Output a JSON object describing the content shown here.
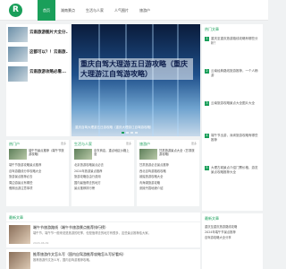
{
  "header": {
    "logo": "R",
    "nav": [
      "首页",
      "湖南景点",
      "生活与人家",
      "人气图片",
      "旅游户"
    ]
  },
  "featured_list": {
    "items": [
      "云南旅游图片大全分...",
      "这都可以？！云南旅...",
      "云南旅游攻略必看..."
    ]
  },
  "banner": {
    "headline": "重庆自驾大理游五日游攻略（重庆大理游江自驾游攻略）",
    "caption": "重庆自驾大理游五日游攻略（重庆大理游江自驾游攻略）"
  },
  "right_hot": {
    "title": "热门文章",
    "items": [
      "重庆至重庆旅游路线攻略有哪些分析？",
      "云南经典路线旅游推荐，一个人畅游",
      "云南旅游攻略景点大全图片大全",
      "端午节出游，深圳旅游攻略有哪些推荐",
      "大理古城景点介绍门票价格，游览景点攻略推荐大全"
    ]
  },
  "cards": [
    {
      "head": "热门户",
      "more": "更多",
      "feat": "端午节景点推荐（端午节旅游攻略）",
      "list": [
        "端午节旅游攻略景点推荐",
        "自驾游路线分享攻略大全",
        "旅游景点推荐必去",
        "周边游景点有哪些",
        "假期出游注意事项"
      ]
    },
    {
      "head": "生活与人家",
      "more": "更多",
      "feat": "京东商店，重点地区价格上涨",
      "list": [
        "北京旅游攻略景点必去",
        "2024年旅游景点推荐",
        "旅游攻略自由行费用",
        "国内最值得去的地方",
        "景点推荐排行榜"
      ]
    },
    {
      "head": "旅游户",
      "more": "更多",
      "feat": "甘肃旅游景点大全（甘肃旅游攻略）",
      "list": [
        "甘肃旅游必去景点推荐",
        "西北自驾游路线攻略",
        "敦煌旅游攻略大全",
        "青海湖旅游攻略",
        "张掖丹霞地貌介绍"
      ]
    }
  ],
  "bottom": {
    "head": "最新文章",
    "articles": [
      {
        "title": "端午节旅游路线（端午节旅游景点推荐排行榜）",
        "desc": "端午节，端午节一般来说是旅游的旺季，但是值得去的地方有很多，这些景点推荐给大家。",
        "meta": "2024-06-09"
      },
      {
        "title": "推荐旅游作文怎么写（国内自驾游推荐攻略怎么写好看吗）",
        "desc": "推荐旅游作文怎么写，国内自驾游推荐攻略。",
        "meta": "2024-06-09"
      }
    ]
  },
  "side_bottom": {
    "title": "最新文章",
    "items": [
      "重庆至重庆旅游路线攻略",
      "2024年端午节景点推荐",
      "自驾游攻略大全分享"
    ]
  }
}
